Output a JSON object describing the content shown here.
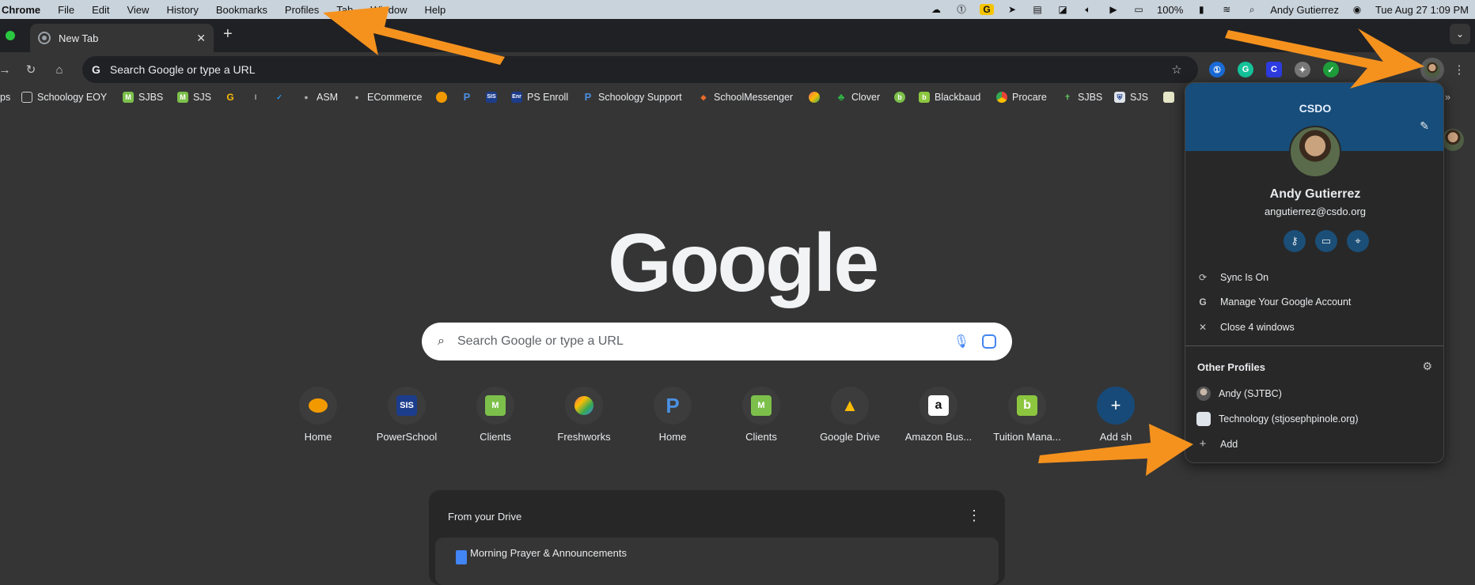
{
  "menubar": {
    "app": "Chrome",
    "items": [
      "File",
      "Edit",
      "View",
      "History",
      "Bookmarks",
      "Profiles",
      "Tab",
      "Window",
      "Help"
    ],
    "battery": "100%",
    "user": "Andy Gutierrez",
    "datetime": "Tue Aug 27  1:09 PM"
  },
  "tab": {
    "title": "New Tab",
    "close": "✕",
    "new_tab": "+"
  },
  "omnibox": {
    "placeholder": "Search Google or type a URL"
  },
  "bookmarks": [
    "ps",
    "Schoology EOY",
    "SJBS",
    "SJS",
    "ASM",
    "ECommerce",
    "PS Enroll",
    "Schoology Support",
    "SchoolMessenger",
    "Clover",
    "Blackbaud",
    "Procare",
    "SJBS",
    "SJS"
  ],
  "ntp": {
    "logo": "Google",
    "search_placeholder": "Search Google or type a URL",
    "shortcuts": [
      "Home",
      "PowerSchool",
      "Clients",
      "Freshworks",
      "Home",
      "Clients",
      "Google Drive",
      "Amazon Bus...",
      "Tuition Mana...",
      "Add sh"
    ],
    "shortcut_marks": [
      "●",
      "SIS",
      "M",
      "◢",
      "P",
      "M",
      "▲",
      "a",
      "b",
      "+"
    ],
    "drive_title": "From your Drive",
    "drive_item": "Morning Prayer & Announcements"
  },
  "profile_panel": {
    "org": "CSDO",
    "name": "Andy Gutierrez",
    "email": "angutierrez@csdo.org",
    "sync": "Sync Is On",
    "manage": "Manage Your Google Account",
    "close_windows": "Close 4 windows",
    "other_profiles": "Other Profiles",
    "profiles": [
      "Andy (SJTBC)",
      "Technology (stjosephpinole.org)"
    ],
    "add": "Add"
  },
  "colors": {
    "accent": "#164d7a",
    "arrow": "#f5921e",
    "background": "#353535"
  }
}
